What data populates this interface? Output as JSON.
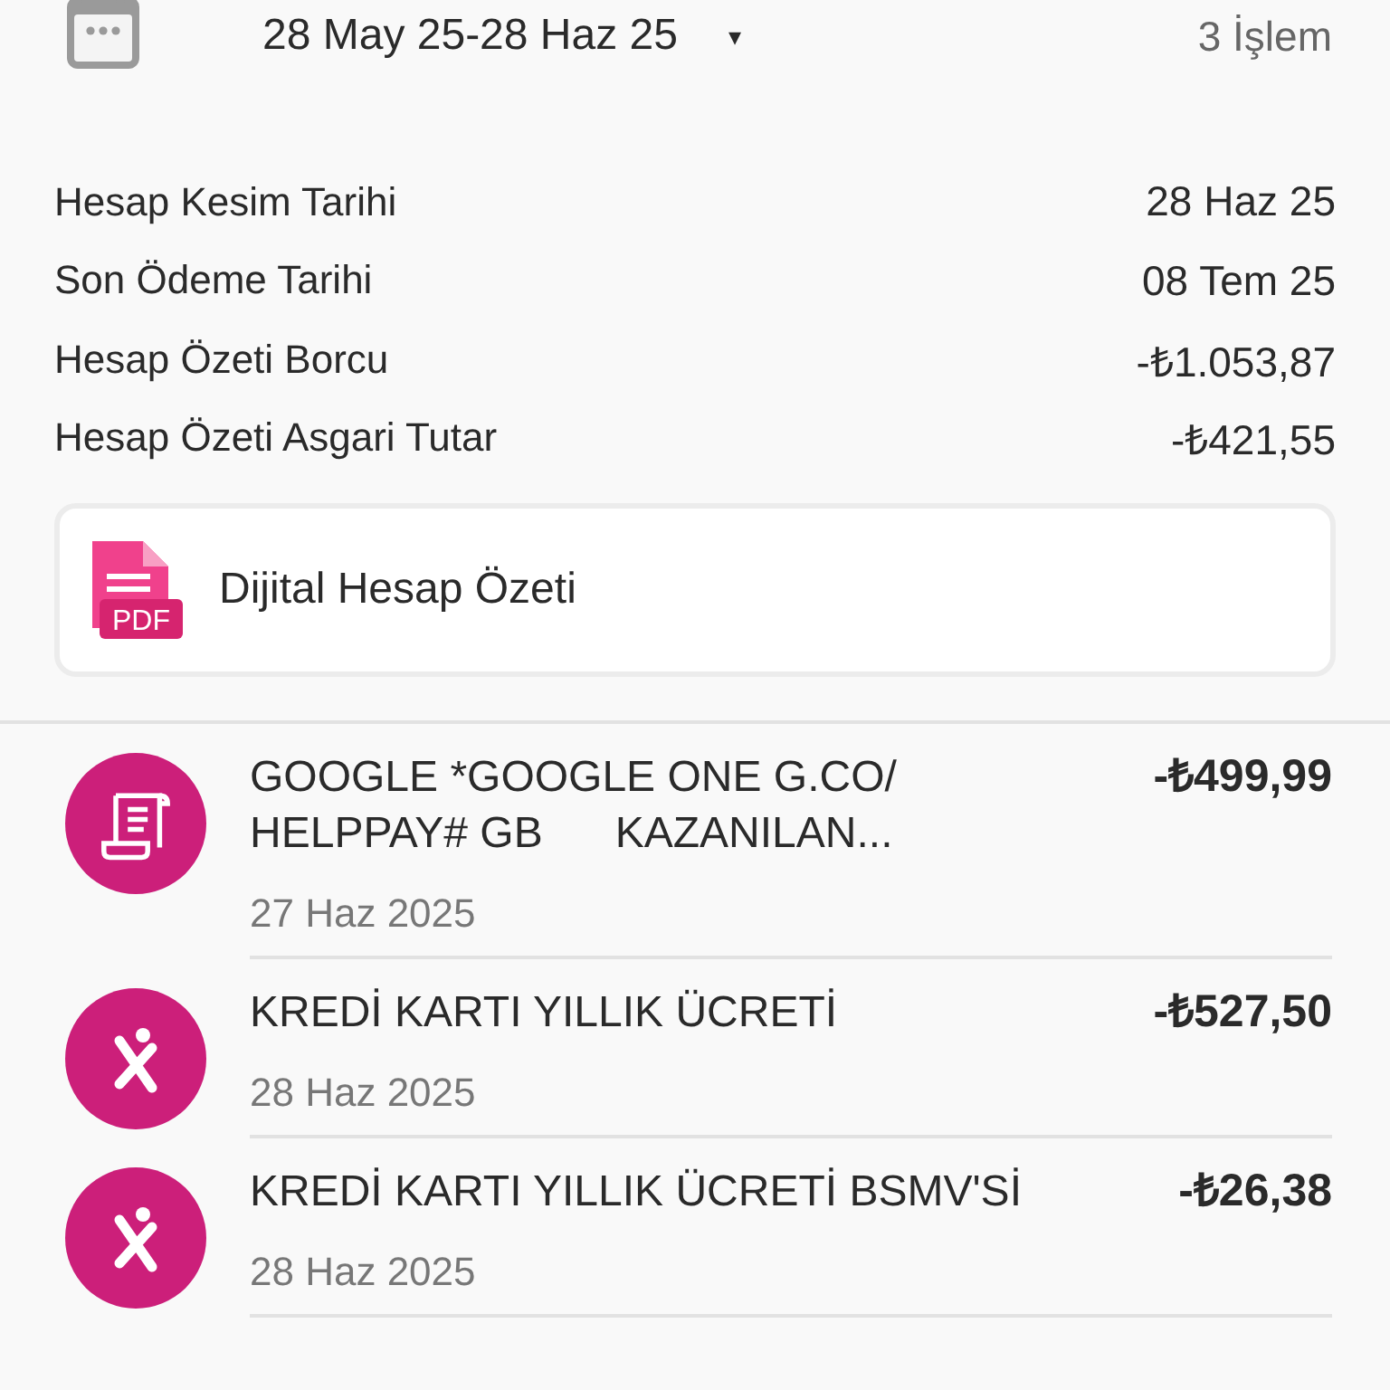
{
  "header": {
    "date_range": "28 May 25-28 Haz 25",
    "dropdown": "▾",
    "count": "3 İşlem"
  },
  "summary": [
    {
      "label": "Hesap Kesim Tarihi",
      "value": "28 Haz 25"
    },
    {
      "label": "Son Ödeme Tarihi",
      "value": "08 Tem 25"
    },
    {
      "label": "Hesap Özeti Borcu",
      "value": "-₺1.053,87"
    },
    {
      "label": "Hesap Özeti Asgari Tutar",
      "value": "-₺421,55"
    }
  ],
  "statement_button": {
    "icon_text": "PDF",
    "label": "Dijital Hesap Özeti"
  },
  "transactions": [
    {
      "kind": "receipt",
      "title": "GOOGLE *GOOGLE ONE G.CO/ HELPPAY# GB      KAZANILAN...",
      "amount": "-₺499,99",
      "date": "27 Haz 2025"
    },
    {
      "kind": "person",
      "title": "KREDİ KARTI YILLIK ÜCRETİ",
      "amount": "-₺527,50",
      "date": "28 Haz 2025"
    },
    {
      "kind": "person",
      "title": "KREDİ KARTI YILLIK ÜCRETİ BSMV'Sİ",
      "amount": "-₺26,38",
      "date": "28 Haz 2025"
    }
  ]
}
